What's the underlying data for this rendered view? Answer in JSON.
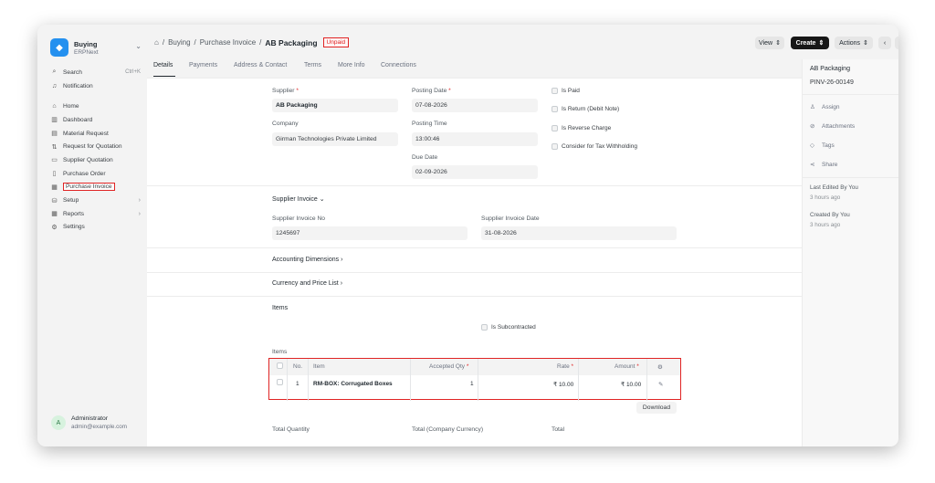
{
  "app": {
    "title": "Buying",
    "subtitle": "ERPNext"
  },
  "sidebar": {
    "search": {
      "label": "Search",
      "shortcut": "Ctrl+K"
    },
    "notification": "Notification",
    "items": [
      {
        "label": "Home",
        "icon": "home-icon"
      },
      {
        "label": "Dashboard",
        "icon": "chart-icon"
      },
      {
        "label": "Material Request",
        "icon": "document-icon"
      },
      {
        "label": "Request for Quotation",
        "icon": "flow-icon"
      },
      {
        "label": "Supplier Quotation",
        "icon": "book-icon"
      },
      {
        "label": "Purchase Order",
        "icon": "file-icon"
      },
      {
        "label": "Purchase Invoice",
        "icon": "invoice-icon"
      },
      {
        "label": "Setup",
        "icon": "database-icon"
      },
      {
        "label": "Reports",
        "icon": "table-icon"
      },
      {
        "label": "Settings",
        "icon": "gear-icon"
      }
    ],
    "user": {
      "initial": "A",
      "name": "Administrator",
      "email": "admin@example.com"
    }
  },
  "breadcrumb": {
    "module": "Buying",
    "doctype": "Purchase Invoice",
    "current": "AB Packaging",
    "status": "Unpaid"
  },
  "toolbar": {
    "view": "View",
    "create": "Create",
    "actions": "Actions"
  },
  "tabs": [
    "Details",
    "Payments",
    "Address & Contact",
    "Terms",
    "More Info",
    "Connections"
  ],
  "form": {
    "supplier": {
      "label": "Supplier",
      "value": "AB Packaging"
    },
    "company": {
      "label": "Company",
      "value": "Girman Technologies Private Limited"
    },
    "posting_date": {
      "label": "Posting Date",
      "value": "07-08-2026"
    },
    "posting_time": {
      "label": "Posting Time",
      "value": "13:00:46"
    },
    "due_date": {
      "label": "Due Date",
      "value": "02-09-2026"
    },
    "checks": [
      "Is Paid",
      "Is Return (Debit Note)",
      "Is Reverse Charge",
      "Consider for Tax Withholding"
    ],
    "supplier_invoice_section": "Supplier Invoice",
    "supplier_invoice_no": {
      "label": "Supplier Invoice No",
      "value": "1245697"
    },
    "supplier_invoice_date": {
      "label": "Supplier Invoice Date",
      "value": "31-08-2026"
    },
    "accounting_dimensions": "Accounting Dimensions",
    "currency_price_list": "Currency and Price List",
    "items_section": "Items",
    "is_subcontracted": "Is Subcontracted",
    "items_label": "Items",
    "table": {
      "headers": {
        "no": "No.",
        "item": "Item",
        "qty": "Accepted Qty",
        "rate": "Rate",
        "amount": "Amount"
      },
      "row": {
        "no": "1",
        "item": "RM-BOX: Corrugated Boxes",
        "qty": "1",
        "rate": "₹ 10.00",
        "amount": "₹ 10.00"
      }
    },
    "download": "Download",
    "totals": {
      "total_qty": "Total Quantity",
      "total_company": "Total (Company Currency)",
      "total": "Total"
    }
  },
  "right_panel": {
    "title": "AB Packaging",
    "id": "PINV-26-00149",
    "actions": [
      "Assign",
      "Attachments",
      "Tags",
      "Share"
    ],
    "last_edited": "Last Edited By You",
    "last_edited_time": "3 hours ago",
    "created": "Created By You",
    "created_time": "3 hours ago"
  },
  "colors": {
    "accent": "#2490ef",
    "highlight": "#e02424",
    "primary_button": "#171717"
  }
}
